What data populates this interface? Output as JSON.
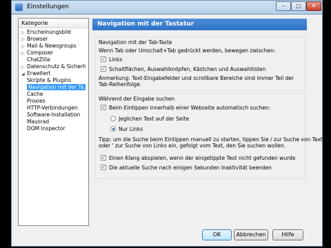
{
  "window": {
    "title": "Einstellungen"
  },
  "titlebar": {
    "min": "–",
    "max": "□",
    "close": "✕"
  },
  "tree": {
    "header": "Kategorie",
    "items": [
      {
        "label": "Erscheinungsbild",
        "twisty": "▷"
      },
      {
        "label": "Browser",
        "twisty": "▷"
      },
      {
        "label": "Mail & Newsgroups",
        "twisty": "▷"
      },
      {
        "label": "Composer",
        "twisty": "▷"
      },
      {
        "label": "ChatZilla",
        "twisty": ""
      },
      {
        "label": "Datenschutz & Sicherheit",
        "twisty": "▷"
      },
      {
        "label": "Erweitert",
        "twisty": "◢"
      },
      {
        "label": "Skripte & Plugins",
        "twisty": ""
      },
      {
        "label": "Navigation mit der Ta...",
        "twisty": ""
      },
      {
        "label": "Cache",
        "twisty": ""
      },
      {
        "label": "Proxies",
        "twisty": ""
      },
      {
        "label": "HTTP-Verbindungen",
        "twisty": ""
      },
      {
        "label": "Software-Installation",
        "twisty": ""
      },
      {
        "label": "Mausrad",
        "twisty": ""
      },
      {
        "label": "DOM Inspector",
        "twisty": ""
      }
    ]
  },
  "pane": {
    "title": "Navigation mit der Tastatur"
  },
  "group1": {
    "caption": "Navigation mit der Tab-Taste",
    "desc": "Wenn Tab oder Umschalt+Tab gedrückt werden, bewegen zwischen:",
    "cb_links": "Links",
    "cb_buttons": "Schaltflächen, Auswahlknöpfen, Kästchen und Auswahllisten",
    "note_line1": "Anmerkung: Text-Eingabefelder und scrollbare Bereiche sind immer Teil der",
    "note_line2": "Tab-Reihenfolge."
  },
  "group2": {
    "caption": "Während der Eingabe suchen",
    "cb_autosearch": "Beim Eintippen innerhalb einer Webseite automatisch suchen:",
    "radio_all": "Jeglichen Text auf der Seite",
    "radio_links": "Nur Links",
    "tip_line1": "Tipp: um die Suche beim Eintippen manuell zu starten, tippen Sie / zur Suche von Text",
    "tip_line2": "oder ' zur Suche von Links ein, gefolgt vom Text, den Sie suchen wollen.",
    "cb_sound": "Einen Klang abspielen, wenn der eingetippte Text nicht gefunden wurde",
    "cb_timeout": "Die aktuelle Suche nach einigen Sekunden Inaktivität beenden"
  },
  "check_mark": "✓",
  "buttons": {
    "ok": "OK",
    "cancel": "Abbrechen",
    "help": "Hilfe"
  }
}
